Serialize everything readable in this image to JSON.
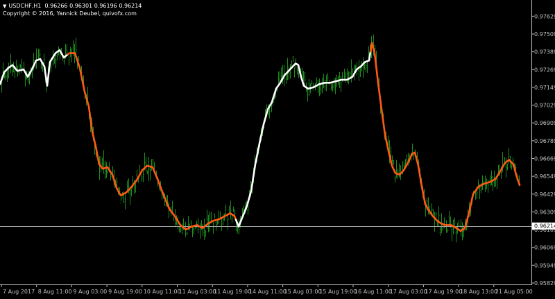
{
  "header": {
    "symbol_timeframe": "USDCHF,H1",
    "ohlc": "0.96266 0.96301 0.96196 0.96214",
    "copyright": "Copyright © 2016, Yannick Deubel, quivofx.com"
  },
  "colors": {
    "background": "#000000",
    "candles": "#1f8c1f",
    "ma_up": "#ffffff",
    "ma_down": "#ff5a14",
    "axis": "#c0c0c0",
    "text": "#ffffff",
    "price_line": "#a0a0a0"
  },
  "chart_data": {
    "type": "line",
    "symbol": "USDCHF",
    "timeframe": "H1",
    "ylim": [
      0.95829,
      0.97729
    ],
    "y_ticks": [
      "0.97629",
      "0.97509",
      "0.97389",
      "0.97269",
      "0.97149",
      "0.97029",
      "0.96909",
      "0.96789",
      "0.96669",
      "0.96549",
      "0.96429",
      "0.96309",
      "0.96189",
      "0.96069",
      "0.95949",
      "0.95829"
    ],
    "current_price": "0.96214",
    "x_ticks": [
      "7 Aug 2017",
      "8 Aug 11:00",
      "9 Aug 03:00",
      "9 Aug 19:00",
      "10 Aug 11:00",
      "11 Aug 03:00",
      "11 Aug 19:00",
      "14 Aug 11:00",
      "15 Aug 03:00",
      "15 Aug 19:00",
      "16 Aug 11:00",
      "17 Aug 03:00",
      "17 Aug 19:00",
      "18 Aug 13:00",
      "21 Aug 05:00"
    ],
    "ma_anchors": [
      [
        0,
        0.9717
      ],
      [
        6,
        0.9725
      ],
      [
        12,
        0.9728
      ],
      [
        18,
        0.973
      ],
      [
        25,
        0.9726
      ],
      [
        34,
        0.9727
      ],
      [
        40,
        0.9722
      ],
      [
        46,
        0.9727
      ],
      [
        52,
        0.9733
      ],
      [
        58,
        0.9734
      ],
      [
        64,
        0.9729
      ],
      [
        68,
        0.9716
      ],
      [
        72,
        0.9732
      ],
      [
        80,
        0.9738
      ],
      [
        86,
        0.974
      ],
      [
        92,
        0.9735
      ],
      [
        100,
        0.9738
      ],
      [
        108,
        0.9738
      ],
      [
        115,
        0.9728
      ],
      [
        122,
        0.9712
      ],
      [
        128,
        0.9702
      ],
      [
        133,
        0.9685
      ],
      [
        138,
        0.9675
      ],
      [
        143,
        0.9663
      ],
      [
        148,
        0.966
      ],
      [
        155,
        0.9661
      ],
      [
        162,
        0.9656
      ],
      [
        168,
        0.9647
      ],
      [
        174,
        0.9642
      ],
      [
        182,
        0.9644
      ],
      [
        190,
        0.9648
      ],
      [
        198,
        0.9653
      ],
      [
        205,
        0.9659
      ],
      [
        212,
        0.9662
      ],
      [
        220,
        0.9661
      ],
      [
        228,
        0.9652
      ],
      [
        236,
        0.9642
      ],
      [
        244,
        0.9633
      ],
      [
        252,
        0.9628
      ],
      [
        260,
        0.9622
      ],
      [
        268,
        0.9619
      ],
      [
        276,
        0.9621
      ],
      [
        284,
        0.9622
      ],
      [
        292,
        0.962
      ],
      [
        300,
        0.9623
      ],
      [
        308,
        0.9625
      ],
      [
        316,
        0.9626
      ],
      [
        324,
        0.9628
      ],
      [
        332,
        0.963
      ],
      [
        338,
        0.9628
      ],
      [
        344,
        0.9621
      ],
      [
        350,
        0.9628
      ],
      [
        356,
        0.9635
      ],
      [
        362,
        0.9645
      ],
      [
        368,
        0.9663
      ],
      [
        374,
        0.9677
      ],
      [
        380,
        0.969
      ],
      [
        386,
        0.97
      ],
      [
        392,
        0.9705
      ],
      [
        398,
        0.9714
      ],
      [
        404,
        0.9718
      ],
      [
        410,
        0.9723
      ],
      [
        418,
        0.9727
      ],
      [
        426,
        0.9731
      ],
      [
        430,
        0.973
      ],
      [
        434,
        0.9722
      ],
      [
        438,
        0.9716
      ],
      [
        444,
        0.9714
      ],
      [
        452,
        0.9715
      ],
      [
        460,
        0.9717
      ],
      [
        468,
        0.9718
      ],
      [
        476,
        0.9718
      ],
      [
        484,
        0.9719
      ],
      [
        492,
        0.972
      ],
      [
        500,
        0.972
      ],
      [
        508,
        0.9722
      ],
      [
        514,
        0.9727
      ],
      [
        520,
        0.9729
      ],
      [
        526,
        0.9732
      ],
      [
        532,
        0.9733
      ],
      [
        536,
        0.9745
      ],
      [
        540,
        0.9738
      ],
      [
        545,
        0.9718
      ],
      [
        550,
        0.97
      ],
      [
        555,
        0.9683
      ],
      [
        560,
        0.9672
      ],
      [
        565,
        0.9662
      ],
      [
        570,
        0.9657
      ],
      [
        576,
        0.9656
      ],
      [
        582,
        0.9659
      ],
      [
        588,
        0.9664
      ],
      [
        594,
        0.967
      ],
      [
        598,
        0.9671
      ],
      [
        603,
        0.9662
      ],
      [
        608,
        0.9648
      ],
      [
        613,
        0.9636
      ],
      [
        618,
        0.9632
      ],
      [
        624,
        0.9628
      ],
      [
        630,
        0.9625
      ],
      [
        636,
        0.9623
      ],
      [
        642,
        0.9622
      ],
      [
        650,
        0.9622
      ],
      [
        658,
        0.962
      ],
      [
        664,
        0.9618
      ],
      [
        670,
        0.962
      ],
      [
        676,
        0.963
      ],
      [
        682,
        0.9643
      ],
      [
        690,
        0.9648
      ],
      [
        698,
        0.965
      ],
      [
        706,
        0.9651
      ],
      [
        714,
        0.9653
      ],
      [
        722,
        0.9659
      ],
      [
        728,
        0.9664
      ],
      [
        734,
        0.9666
      ],
      [
        740,
        0.9663
      ],
      [
        744,
        0.9656
      ],
      [
        749,
        0.9649
      ]
    ],
    "ma_segments": [
      {
        "trend": "up",
        "from": 0,
        "to": 98
      },
      {
        "trend": "down",
        "from": 98,
        "to": 340
      },
      {
        "trend": "up",
        "from": 340,
        "to": 534
      },
      {
        "trend": "down",
        "from": 534,
        "to": 749
      }
    ]
  }
}
